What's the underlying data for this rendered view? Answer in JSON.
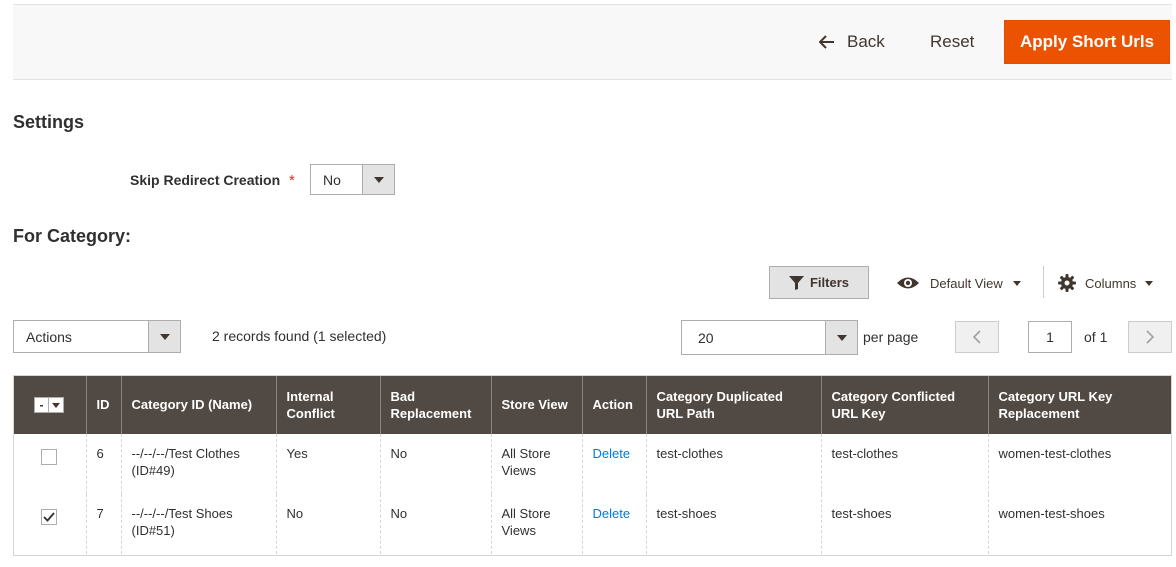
{
  "toolbar": {
    "back_label": "Back",
    "reset_label": "Reset",
    "apply_label": "Apply Short Urls"
  },
  "settings": {
    "title": "Settings",
    "skip_redirect": {
      "label": "Skip Redirect Creation",
      "required": "*",
      "value": "No"
    }
  },
  "category_section": {
    "title": "For Category:"
  },
  "grid_controls": {
    "filters_label": "Filters",
    "view_label": "Default View",
    "columns_label": "Columns",
    "actions_label": "Actions",
    "records_found": "2 records found (1 selected)",
    "per_page_value": "20",
    "per_page_label": "per page",
    "current_page": "1",
    "of_pages": "of 1"
  },
  "grid": {
    "mass_select_glyph": "-",
    "headers": [
      "ID",
      "Category ID (Name)",
      "Internal Conflict",
      "Bad Replacement",
      "Store View",
      "Action",
      "Category Duplicated URL Path",
      "Category Conflicted URL Key",
      "Category URL Key Replacement"
    ],
    "rows": [
      {
        "checked": false,
        "id": "6",
        "category": "--/--/--/Test Clothes (ID#49)",
        "internal_conflict": "Yes",
        "bad_replacement": "No",
        "store_view": "All Store Views",
        "action": "Delete",
        "duplicated_path": "test-clothes",
        "conflicted_key": "test-clothes",
        "replacement": "women-test-clothes"
      },
      {
        "checked": true,
        "id": "7",
        "category": "--/--/--/Test Shoes (ID#51)",
        "internal_conflict": "No",
        "bad_replacement": "No",
        "store_view": "All Store Views",
        "action": "Delete",
        "duplicated_path": "test-shoes",
        "conflicted_key": "test-shoes",
        "replacement": "women-test-shoes"
      }
    ]
  },
  "colors": {
    "primary_button": "#eb5202",
    "header_bg": "#514943",
    "link": "#007bdb"
  }
}
